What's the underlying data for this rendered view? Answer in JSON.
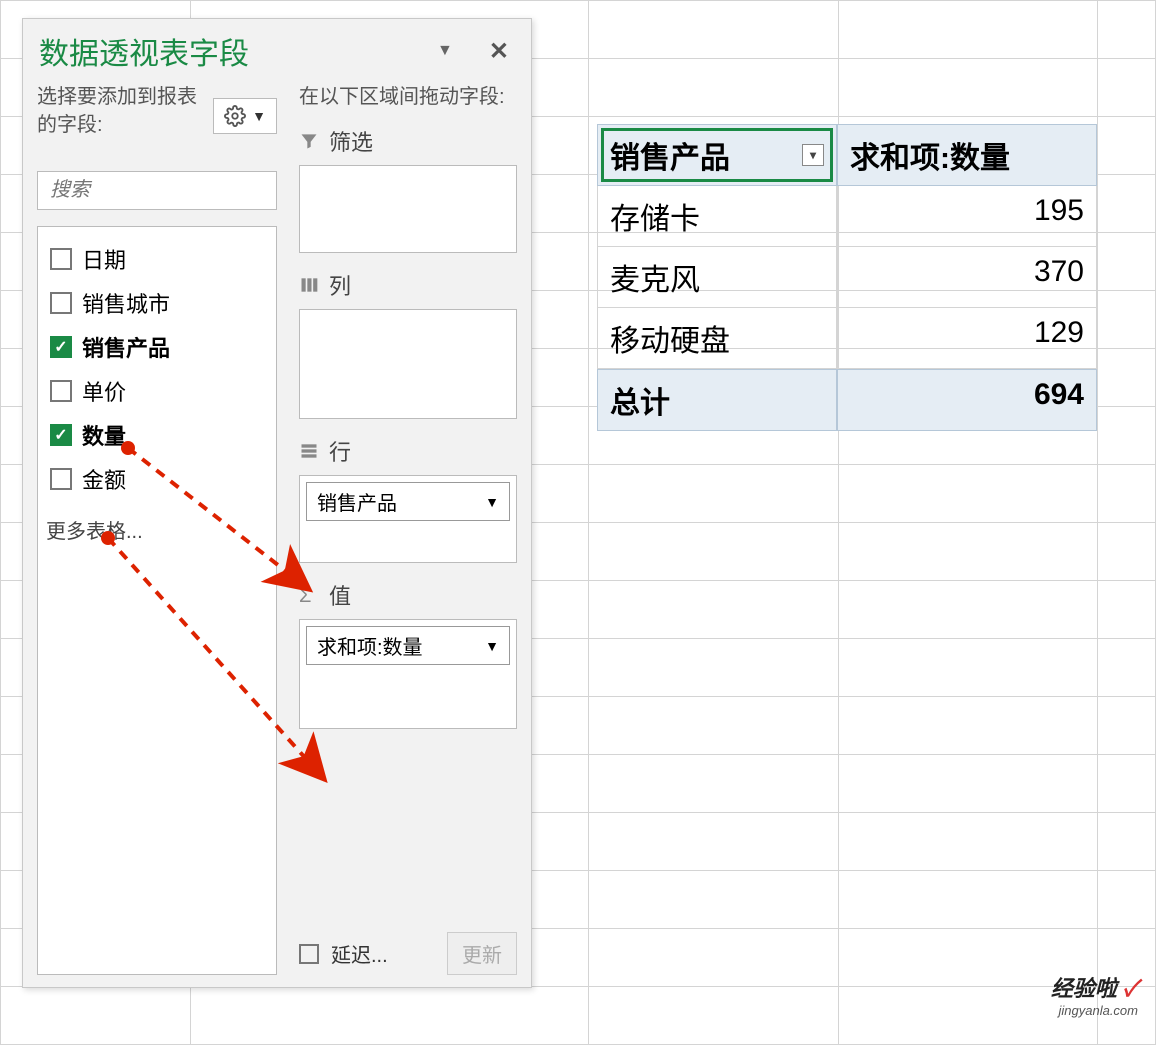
{
  "pane": {
    "title": "数据透视表字段",
    "choose_label": "选择要添加到报表的字段:",
    "search_placeholder": "搜索",
    "fields": [
      {
        "label": "日期",
        "checked": false,
        "bold": false
      },
      {
        "label": "销售城市",
        "checked": false,
        "bold": false
      },
      {
        "label": "销售产品",
        "checked": true,
        "bold": true
      },
      {
        "label": "单价",
        "checked": false,
        "bold": false
      },
      {
        "label": "数量",
        "checked": true,
        "bold": true
      },
      {
        "label": "金额",
        "checked": false,
        "bold": false
      }
    ],
    "more_tables": "更多表格...",
    "drag_label": "在以下区域间拖动字段:",
    "zones": {
      "filter": {
        "title": "筛选"
      },
      "columns": {
        "title": "列"
      },
      "rows": {
        "title": "行",
        "chip": "销售产品"
      },
      "values": {
        "title": "值",
        "chip": "求和项:数量"
      }
    },
    "defer_label": "延迟...",
    "update_label": "更新"
  },
  "pivot": {
    "col1_header": "销售产品",
    "col2_header": "求和项:数量",
    "rows": [
      {
        "label": "存储卡",
        "value": "195"
      },
      {
        "label": "麦克风",
        "value": "370"
      },
      {
        "label": "移动硬盘",
        "value": "129"
      }
    ],
    "total_label": "总计",
    "total_value": "694"
  },
  "watermark": {
    "line1a": "经验啦",
    "line1b": "✓",
    "line2": "jingyanla.com"
  }
}
